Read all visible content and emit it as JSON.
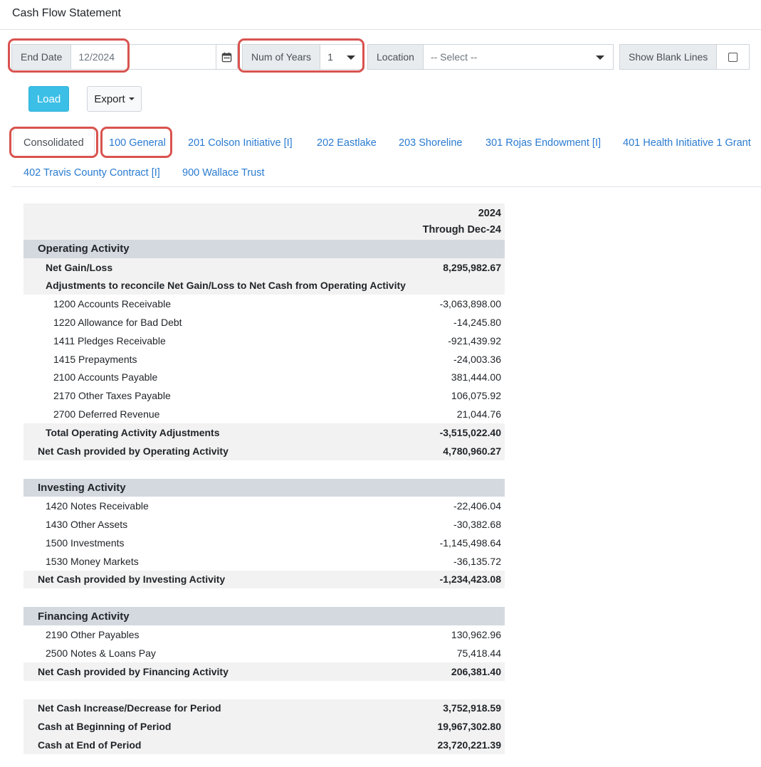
{
  "page": {
    "title": "Cash Flow Statement"
  },
  "filters": {
    "end_date_label": "End Date",
    "end_date_value": "12/2024",
    "num_years_label": "Num of Years",
    "num_years_value": "1",
    "location_label": "Location",
    "location_placeholder": "-- Select --",
    "show_blank_lines_label": "Show Blank Lines"
  },
  "actions": {
    "load_label": "Load",
    "export_label": "Export"
  },
  "tabs": [
    {
      "label": "Consolidated"
    },
    {
      "label": "100 General"
    },
    {
      "label": "201 Colson Initiative [I]"
    },
    {
      "label": "202 Eastlake"
    },
    {
      "label": "203 Shoreline"
    },
    {
      "label": "301 Rojas Endowment [I]"
    },
    {
      "label": "401 Health Initiative 1 Grant"
    },
    {
      "label": "402 Travis County Contract [I]"
    },
    {
      "label": "900 Wallace Trust"
    }
  ],
  "report": {
    "col_year": "2024",
    "col_period": "Through Dec-24",
    "operating": {
      "title": "Operating Activity",
      "net_gain_label": "Net Gain/Loss",
      "net_gain_value": "8,295,982.67",
      "adjustments_label": "Adjustments to reconcile Net Gain/Loss to Net Cash from Operating Activity",
      "lines": [
        {
          "label": "1200 Accounts Receivable",
          "value": "-3,063,898.00"
        },
        {
          "label": "1220 Allowance for Bad Debt",
          "value": "-14,245.80"
        },
        {
          "label": "1411 Pledges Receivable",
          "value": "-921,439.92"
        },
        {
          "label": "1415 Prepayments",
          "value": "-24,003.36"
        },
        {
          "label": "2100 Accounts Payable",
          "value": "381,444.00"
        },
        {
          "label": "2170 Other Taxes Payable",
          "value": "106,075.92"
        },
        {
          "label": "2700 Deferred Revenue",
          "value": "21,044.76"
        }
      ],
      "total_adj_label": "Total Operating Activity Adjustments",
      "total_adj_value": "-3,515,022.40",
      "net_label": "Net Cash provided by Operating Activity",
      "net_value": "4,780,960.27"
    },
    "investing": {
      "title": "Investing Activity",
      "lines": [
        {
          "label": "1420 Notes Receivable",
          "value": "-22,406.04"
        },
        {
          "label": "1430 Other Assets",
          "value": "-30,382.68"
        },
        {
          "label": "1500 Investments",
          "value": "-1,145,498.64"
        },
        {
          "label": "1530 Money Markets",
          "value": "-36,135.72"
        }
      ],
      "net_label": "Net Cash provided by Investing Activity",
      "net_value": "-1,234,423.08"
    },
    "financing": {
      "title": "Financing Activity",
      "lines": [
        {
          "label": "2190 Other Payables",
          "value": "130,962.96"
        },
        {
          "label": "2500 Notes & Loans Pay",
          "value": "75,418.44"
        }
      ],
      "net_label": "Net Cash provided by Financing Activity",
      "net_value": "206,381.40"
    },
    "summary": {
      "increase_label": "Net Cash Increase/Decrease for Period",
      "increase_value": "3,752,918.59",
      "beginning_label": "Cash at Beginning of Period",
      "beginning_value": "19,967,302.80",
      "end_label": "Cash at End of Period",
      "end_value": "23,720,221.39"
    }
  }
}
